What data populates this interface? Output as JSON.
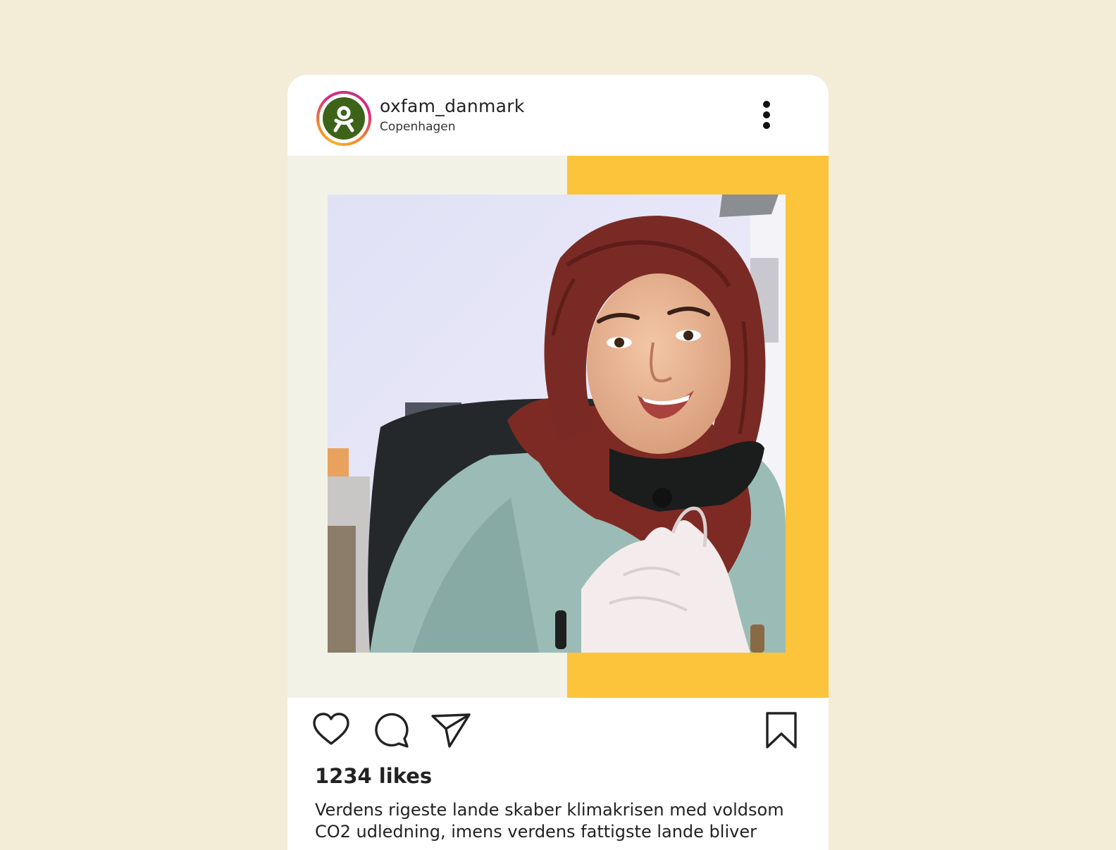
{
  "post": {
    "username": "oxfam_danmark",
    "location": "Copenhagen",
    "likes": "1234 likes",
    "caption": "Verdens rigeste lande skaber klimakrisen med voldsom CO2 udledning, imens verdens fattigste lande bliver"
  },
  "icons": {
    "avatar": "oxfam-logo-icon",
    "more": "more-vertical-icon",
    "like": "heart-icon",
    "comment": "comment-icon",
    "share": "send-icon",
    "save": "bookmark-icon"
  },
  "colors": {
    "background": "#f3ecd7",
    "card": "#ffffff",
    "accent_yellow": "#fbc43a",
    "media_panel": "#f3f2e6",
    "oxfam_green": "#3d6319"
  }
}
